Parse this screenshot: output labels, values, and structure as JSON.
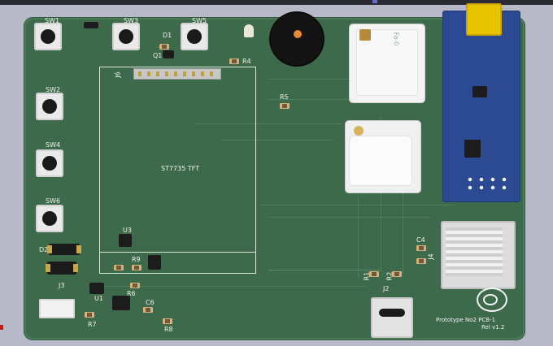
{
  "board": {
    "tft_label": "ST7735 TFT",
    "footer_line1": "Prototype No2 PCB-1",
    "footer_line2": "Rel v1.2",
    "module_a_label": "Fa-0"
  },
  "refs": {
    "sw1": "SW1",
    "sw3": "SW3",
    "sw5": "SW5",
    "sw2": "SW2",
    "sw4": "SW4",
    "sw6": "SW6",
    "d1": "D1",
    "d2": "D2",
    "q1": "Q1",
    "r4": "R4",
    "r5": "R5",
    "j6": "J6",
    "u3": "U3",
    "r9": "R9",
    "j3": "J3",
    "u1": "U1",
    "r6": "R6",
    "r7": "R7",
    "c6": "C6",
    "r8": "R8",
    "j2": "J2",
    "c4": "C4",
    "r1": "R1",
    "r2": "R2",
    "j4": "J4"
  },
  "colors": {
    "board": "#3d6a4a",
    "silkscreen": "#f2f2f2",
    "copper": "#c8a84a",
    "module_blue": "#2b4a92",
    "yellow_part": "#e8c400",
    "background": "#b7b8c8"
  },
  "icons": [
    "tactile-switch-icon",
    "buzzer-icon",
    "antenna-icon",
    "usb-c-icon",
    "microsd-slot-icon",
    "logo-icon"
  ]
}
